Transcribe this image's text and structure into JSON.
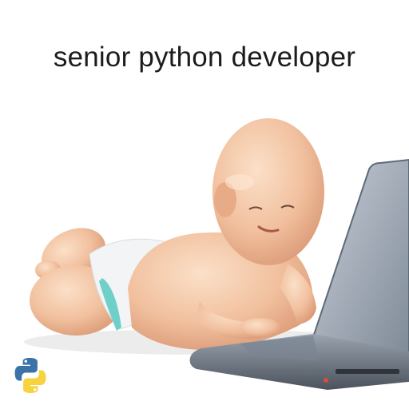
{
  "caption": {
    "text": "senior python developer"
  },
  "icons": {
    "logo": "python-logo-icon"
  },
  "colors": {
    "background": "#ffffff",
    "caption_text": "#1c1c1c",
    "python_blue": "#3b73a8",
    "python_yellow": "#f6d33f",
    "skin": "#f1c09e",
    "diaper": "#f2f4f5",
    "diaper_band": "#6fd0c9",
    "laptop_body": "#8f9aa8",
    "laptop_dark": "#3a3f47"
  }
}
